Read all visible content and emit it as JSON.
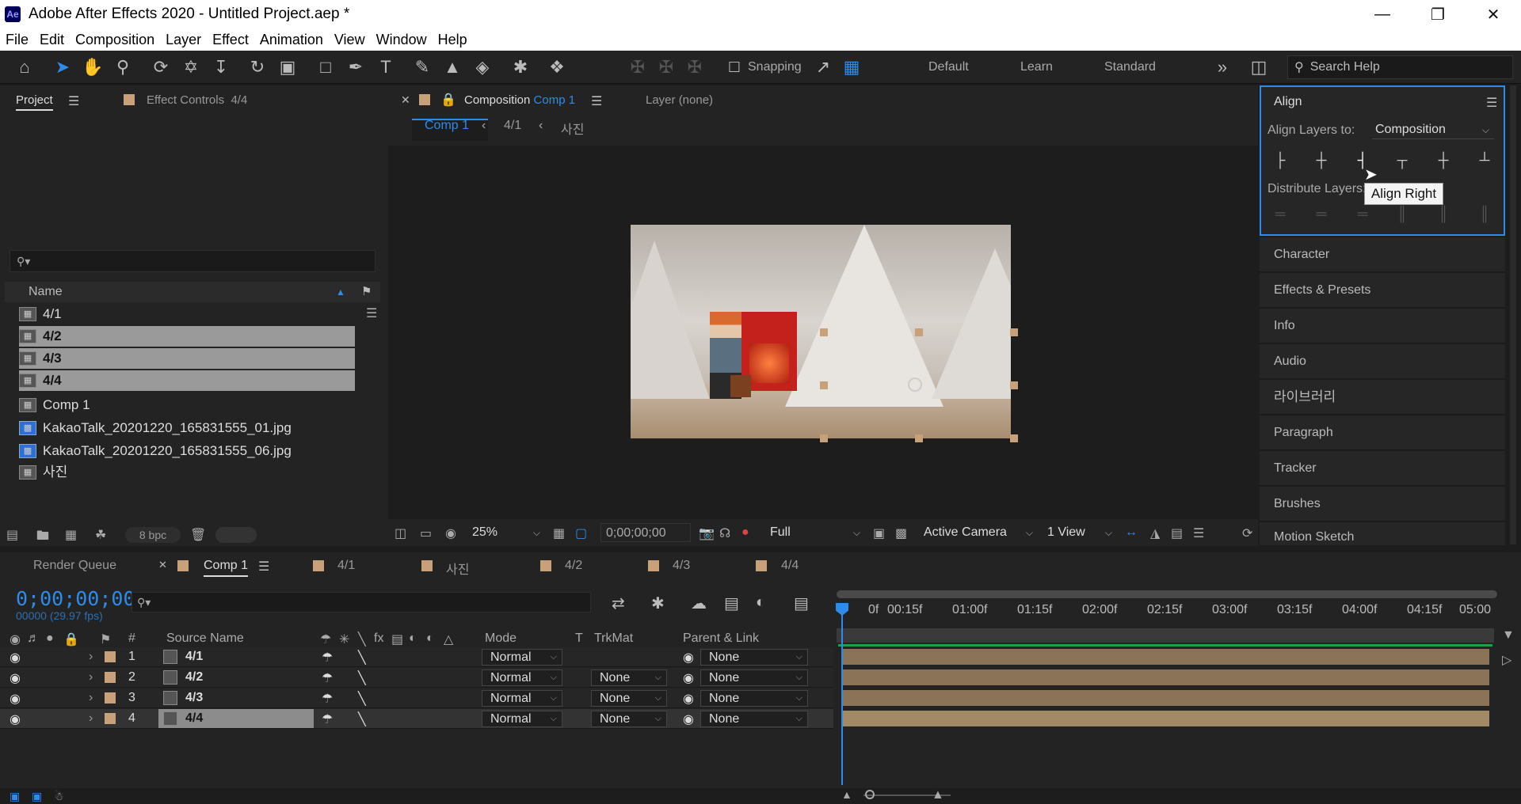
{
  "app": {
    "icon_label": "Ae",
    "title": "Adobe After Effects 2020 - Untitled Project.aep *"
  },
  "menu": [
    "File",
    "Edit",
    "Composition",
    "Layer",
    "Effect",
    "Animation",
    "View",
    "Window",
    "Help"
  ],
  "toolbar": {
    "snapping_label": "Snapping",
    "workspaces": [
      "Default",
      "Learn",
      "Standard"
    ],
    "search_placeholder": "Search Help"
  },
  "project_panel": {
    "tab_project": "Project",
    "tab_effect_controls": "Effect Controls",
    "effect_controls_target": "4/4",
    "column_name": "Name",
    "items": [
      {
        "name": "4/1",
        "type": "comp",
        "selected": false
      },
      {
        "name": "4/2",
        "type": "comp",
        "selected": true
      },
      {
        "name": "4/3",
        "type": "comp",
        "selected": true
      },
      {
        "name": "4/4",
        "type": "comp",
        "selected": true
      },
      {
        "name": "Comp 1",
        "type": "comp",
        "selected": false
      },
      {
        "name": "KakaoTalk_20201220_165831555_01.jpg",
        "type": "image",
        "selected": false
      },
      {
        "name": "KakaoTalk_20201220_165831555_06.jpg",
        "type": "image",
        "selected": false
      },
      {
        "name": "사진",
        "type": "comp",
        "selected": false
      }
    ],
    "bpc": "8 bpc"
  },
  "composition_panel": {
    "tab_label": "Composition",
    "tab_comp": "Comp 1",
    "layer_tab": "Layer (none)",
    "breadcrumbs": [
      "Comp 1",
      "4/1",
      "사진"
    ],
    "zoom": "25%",
    "timecode": "0;00;00;00",
    "resolution": "Full",
    "camera": "Active Camera",
    "views": "1 View"
  },
  "align_panel": {
    "title": "Align",
    "align_layers_to_label": "Align Layers to:",
    "align_layers_to_value": "Composition",
    "distribute_label": "Distribute Layers:",
    "tooltip": "Align Right"
  },
  "side_panels": [
    "Character",
    "Effects & Presets",
    "Info",
    "Audio",
    "라이브러리",
    "Paragraph",
    "Tracker",
    "Brushes",
    "Motion Sketch"
  ],
  "timeline": {
    "tabs": [
      "Render Queue",
      "Comp 1",
      "4/1",
      "사진",
      "4/2",
      "4/3",
      "4/4"
    ],
    "active_tab": "Comp 1",
    "timecode": "0;00;00;00",
    "fps": "00000 (29.97 fps)",
    "columns": {
      "num": "#",
      "source": "Source Name",
      "mode": "Mode",
      "t": "T",
      "trkmat": "TrkMat",
      "parent": "Parent & Link"
    },
    "ruler": [
      "0f",
      "00:15f",
      "01:00f",
      "01:15f",
      "02:00f",
      "02:15f",
      "03:00f",
      "03:15f",
      "04:00f",
      "04:15f",
      "05:00"
    ],
    "layers": [
      {
        "num": "1",
        "name": "4/1",
        "mode": "Normal",
        "trkmat": "",
        "parent": "None",
        "selected": false
      },
      {
        "num": "2",
        "name": "4/2",
        "mode": "Normal",
        "trkmat": "None",
        "parent": "None",
        "selected": false
      },
      {
        "num": "3",
        "name": "4/3",
        "mode": "Normal",
        "trkmat": "None",
        "parent": "None",
        "selected": false
      },
      {
        "num": "4",
        "name": "4/4",
        "mode": "Normal",
        "trkmat": "None",
        "parent": "None",
        "selected": true
      }
    ]
  },
  "colors": {
    "accent": "#2d8ceb",
    "label_sandstone": "#c8a07a",
    "layer_bar": "#8a7356",
    "work_area_green": "#20a040"
  }
}
